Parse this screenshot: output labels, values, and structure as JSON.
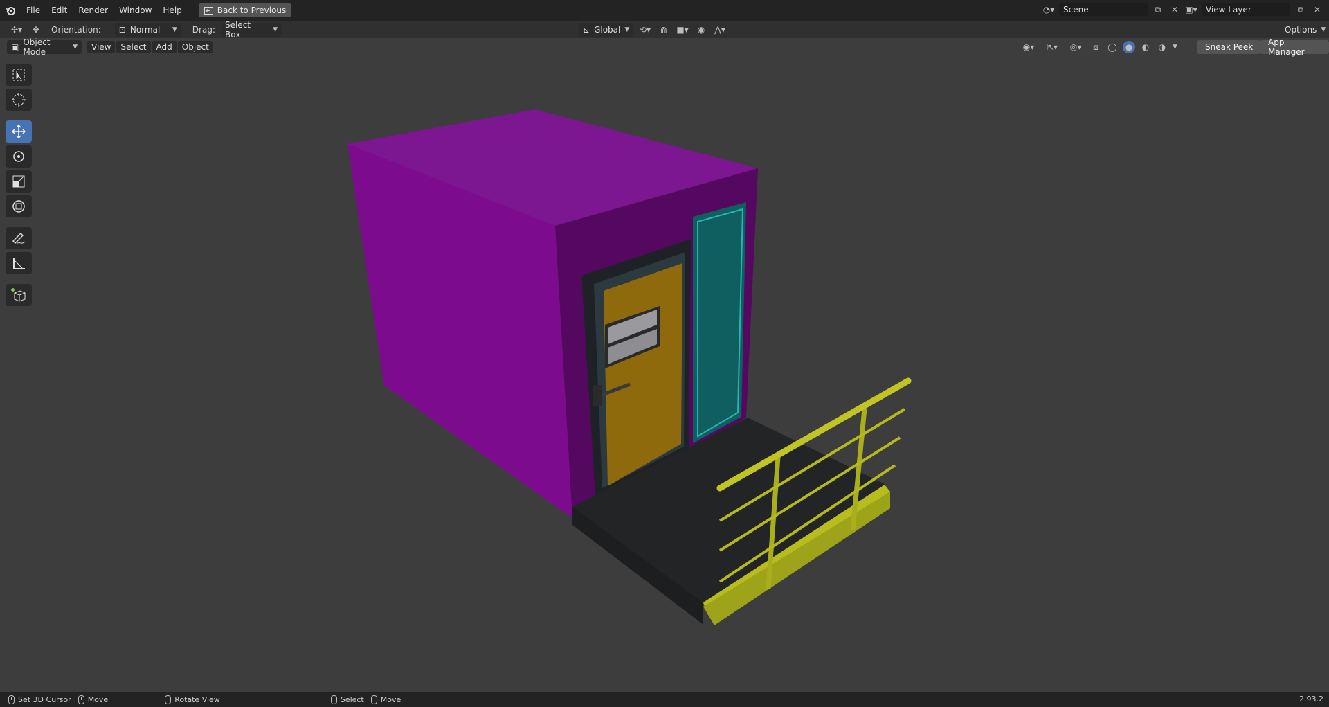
{
  "topbar": {
    "menus": [
      "File",
      "Edit",
      "Render",
      "Window",
      "Help"
    ],
    "back_label": "Back to Previous",
    "scene_name": "Scene",
    "view_layer_name": "View Layer"
  },
  "toolbar": {
    "orientation_label": "Orientation:",
    "orientation_value": "Normal",
    "drag_label": "Drag:",
    "drag_value": "Select Box",
    "transform_space": "Global",
    "options_label": "Options"
  },
  "header": {
    "mode": "Object Mode",
    "menus": [
      "View",
      "Select",
      "Add",
      "Object"
    ],
    "sneak_peek": "Sneak Peek",
    "app_manager": "App Manager"
  },
  "tools": [
    "select-box-icon",
    "cursor-icon",
    "move-icon",
    "rotate-icon",
    "scale-icon",
    "transform-icon",
    "annotate-icon",
    "measure-icon",
    "add-cube-icon"
  ],
  "status": {
    "set_cursor": "Set 3D Cursor",
    "move1": "Move",
    "rotate_view": "Rotate View",
    "select": "Select",
    "move2": "Move",
    "version": "2.93.2"
  },
  "colors": {
    "accent": "#4772b3",
    "container": "#7a0a8a",
    "door": "#8f6a0c",
    "panel": "#0f5a5c",
    "railing": "#b8bd1f"
  }
}
